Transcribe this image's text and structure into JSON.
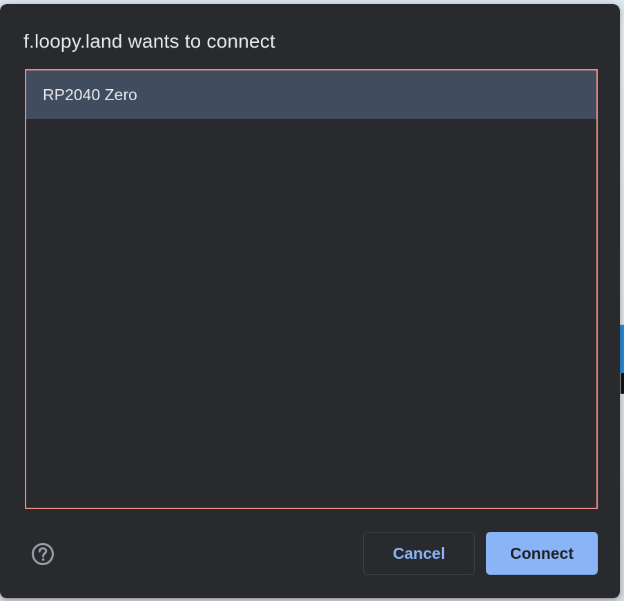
{
  "dialog": {
    "title": "f.loopy.land wants to connect",
    "devices": [
      {
        "label": "RP2040 Zero",
        "selected": true
      }
    ],
    "help_icon": "question-circle-icon",
    "cancel_label": "Cancel",
    "connect_label": "Connect"
  },
  "colors": {
    "dialog_bg": "#292a2d",
    "selected_row": "#414c5e",
    "list_border": "#f28b82",
    "accent": "#8ab4f8",
    "text": "#e8eaed"
  }
}
